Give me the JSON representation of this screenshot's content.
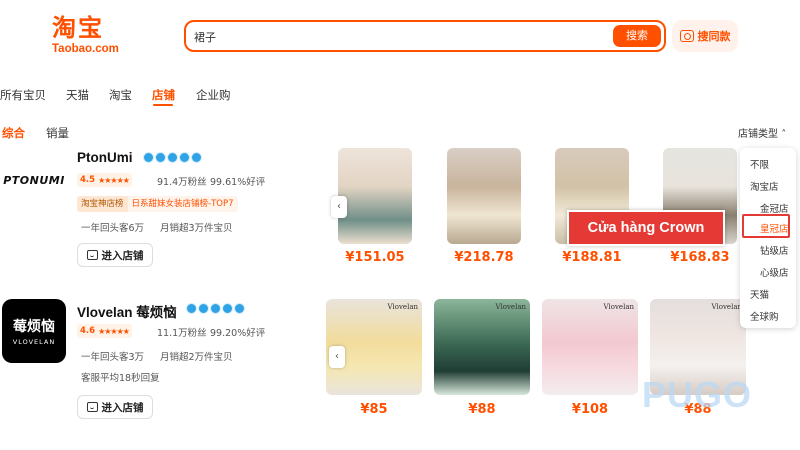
{
  "header": {
    "logo_main": "淘宝",
    "logo_sub": "Taobao.com",
    "search_value": "裙子",
    "search_button": "搜索",
    "image_search": "搜同款"
  },
  "tabs": [
    "所有宝贝",
    "天猫",
    "淘宝",
    "店铺",
    "企业购"
  ],
  "active_tab": "店铺",
  "sort": {
    "comprehensive": "综合",
    "sales": "销量",
    "shop_type": "店铺类型"
  },
  "shops": [
    {
      "logo_text": "PTONUMI",
      "name": "PtonUmi",
      "rating": "4.5",
      "fans": "91.4万粉丝",
      "positive": "99.61%好评",
      "rank_label": "淘宝神店榜",
      "rank_detail": "日系甜妹女装店铺榜-TOP7",
      "repeat_buyers": "一年回头客6万",
      "monthly_sales": "月销超3万件宝贝",
      "enter": "进入店铺",
      "prices": [
        "¥151.05",
        "¥218.78",
        "¥188.81",
        "¥168.83"
      ]
    },
    {
      "logo_cn": "莓烦恼",
      "logo_en": "VLOVELAN",
      "name": "Vlovelan 莓烦恼",
      "rating": "4.6",
      "fans": "11.1万粉丝",
      "positive": "99.20%好评",
      "repeat_buyers": "一年回头客3万",
      "monthly_sales": "月销超2万件宝贝",
      "reply_time": "客服平均18秒回复",
      "enter": "进入店铺",
      "brand_tag": "Vlovelan",
      "prices": [
        "¥85",
        "¥88",
        "¥108",
        "¥88"
      ]
    }
  ],
  "dropdown": {
    "items": [
      "不限",
      "淘宝店",
      "金冠店",
      "皇冠店",
      "钻级店",
      "心级店",
      "天猫",
      "全球购"
    ],
    "selected": "皇冠店"
  },
  "annotation": "Cửa hàng Crown",
  "watermark": "PUGO",
  "colors": {
    "accent": "#ff5000",
    "annotation": "#e53935",
    "crown": "#2fa3e6"
  }
}
